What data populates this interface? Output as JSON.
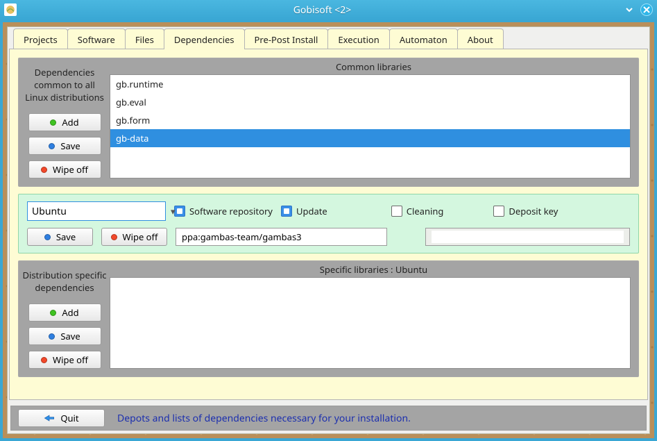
{
  "window": {
    "title": "Gobisoft <2>"
  },
  "tabs": [
    {
      "label": "Projects"
    },
    {
      "label": "Software"
    },
    {
      "label": "Files"
    },
    {
      "label": "Dependencies",
      "active": true
    },
    {
      "label": "Pre-Post Install"
    },
    {
      "label": "Execution"
    },
    {
      "label": "Automaton"
    },
    {
      "label": "About"
    }
  ],
  "common": {
    "caption": "Dependencies common to all Linux distributions",
    "header": "Common libraries",
    "buttons": {
      "add": "Add",
      "save": "Save",
      "wipe": "Wipe off"
    },
    "items": [
      {
        "label": "gb.runtime",
        "selected": false
      },
      {
        "label": "gb.eval",
        "selected": false
      },
      {
        "label": "gb.form",
        "selected": false
      },
      {
        "label": "gb-data",
        "selected": true
      }
    ]
  },
  "mid": {
    "distro_value": "Ubuntu",
    "checks": {
      "repo": {
        "label": "Software repository",
        "checked": true
      },
      "update": {
        "label": "Update",
        "checked": true
      },
      "clean": {
        "label": "Cleaning",
        "checked": false
      },
      "deposit": {
        "label": "Deposit key",
        "checked": false
      }
    },
    "buttons": {
      "save": "Save",
      "wipe": "Wipe off"
    },
    "repo_field": "ppa:gambas-team/gambas3",
    "deposit_field": ""
  },
  "specific": {
    "caption": "Distribution specific dependencies",
    "header": "Specific libraries : Ubuntu",
    "buttons": {
      "add": "Add",
      "save": "Save",
      "wipe": "Wipe off"
    },
    "items": []
  },
  "footer": {
    "quit": "Quit",
    "status": "Depots and lists of dependencies necessary for your installation."
  }
}
